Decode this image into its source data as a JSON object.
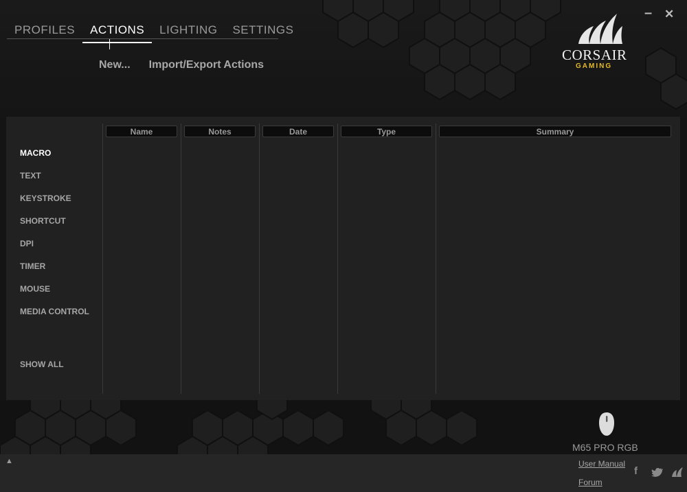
{
  "nav": {
    "tabs": [
      "PROFILES",
      "ACTIONS",
      "LIGHTING",
      "SETTINGS"
    ],
    "active": "ACTIONS"
  },
  "subactions": {
    "new_label": "New...",
    "import_export_label": "Import/Export Actions"
  },
  "window": {
    "minimize_glyph": "–",
    "close_glyph": "✕"
  },
  "brand": {
    "name": "CORSAIR",
    "tagline": "GAMING",
    "accent_color": "#e5b92a"
  },
  "categories": [
    "MACRO",
    "TEXT",
    "KEYSTROKE",
    "SHORTCUT",
    "DPI",
    "TIMER",
    "MOUSE",
    "MEDIA CONTROL"
  ],
  "active_category": "MACRO",
  "show_all_label": "SHOW ALL",
  "table": {
    "columns": [
      "Name",
      "Notes",
      "Date",
      "Type",
      "Summary"
    ],
    "rows": []
  },
  "device": {
    "name": "M65 PRO RGB",
    "icon": "mouse-icon"
  },
  "footer": {
    "user_manual_label": "User Manual",
    "forum_label": "Forum",
    "expand_glyph": "▲",
    "social_icons": [
      "facebook-icon",
      "twitter-icon",
      "corsair-icon"
    ]
  }
}
